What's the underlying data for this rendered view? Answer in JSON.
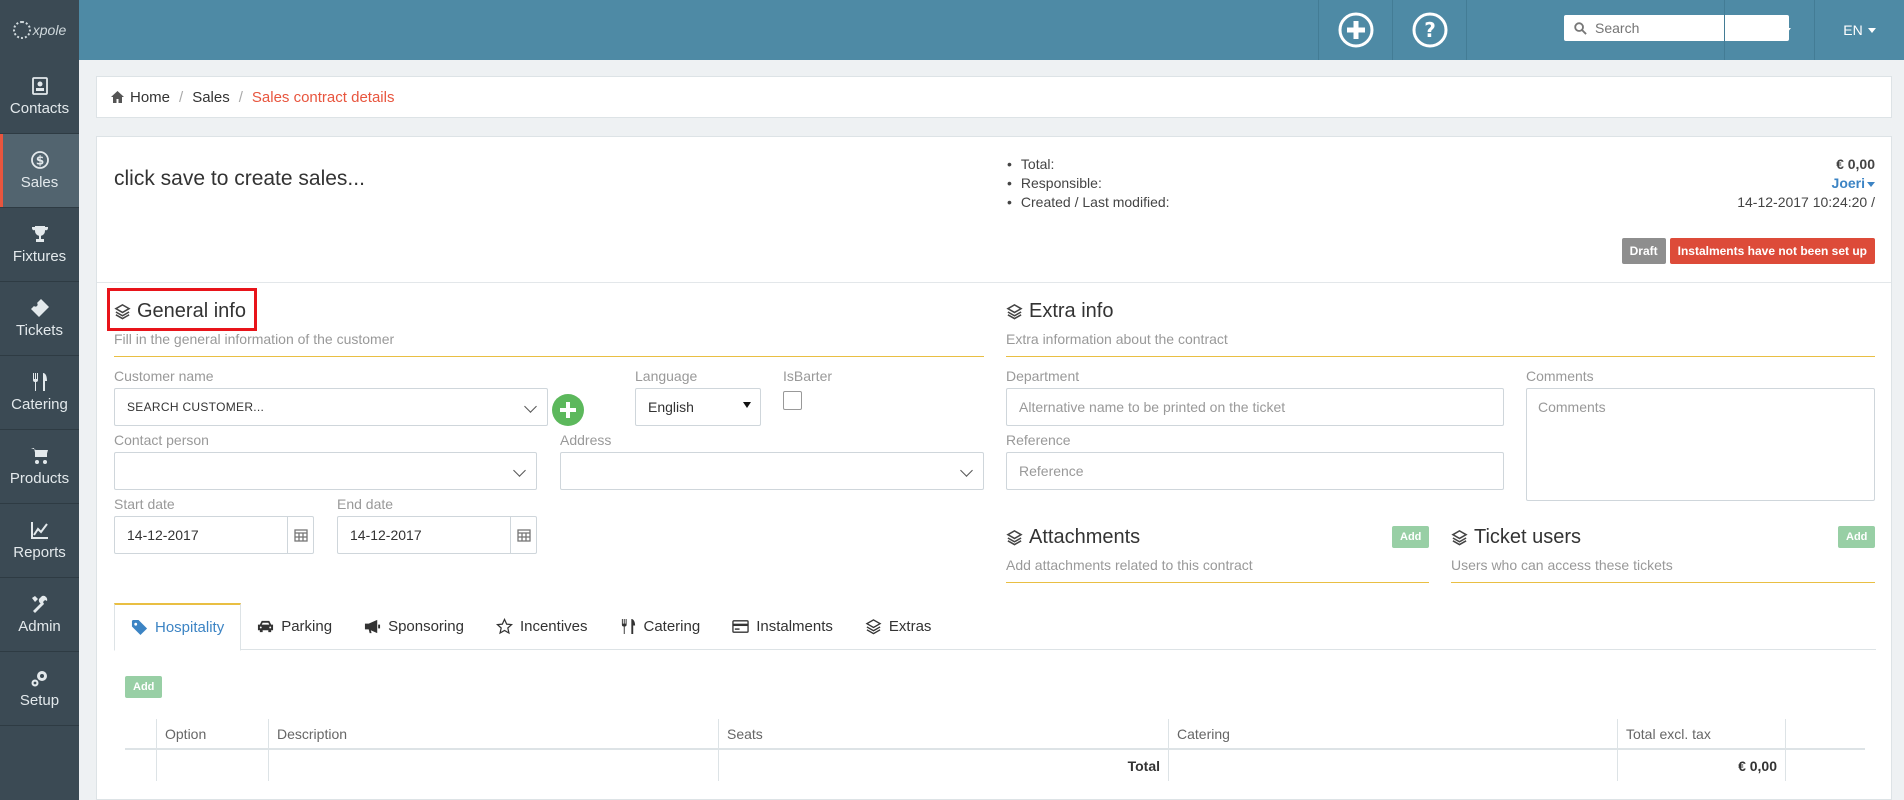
{
  "logo": {
    "text": "xpole"
  },
  "sidebar": {
    "items": [
      {
        "label": "Contacts",
        "icon": "contacts-icon"
      },
      {
        "label": "Sales",
        "icon": "dollar-icon",
        "active": true
      },
      {
        "label": "Fixtures",
        "icon": "trophy-icon"
      },
      {
        "label": "Tickets",
        "icon": "ticket-icon"
      },
      {
        "label": "Catering",
        "icon": "cutlery-icon"
      },
      {
        "label": "Products",
        "icon": "cart-icon"
      },
      {
        "label": "Reports",
        "icon": "chart-icon"
      },
      {
        "label": "Admin",
        "icon": "tools-icon"
      },
      {
        "label": "Setup",
        "icon": "gears-icon"
      }
    ]
  },
  "topbar": {
    "search_placeholder": "Search",
    "user": "Joeri",
    "lang": "EN"
  },
  "breadcrumb": {
    "home": "Home",
    "section": "Sales",
    "current": "Sales contract details"
  },
  "header": {
    "headline": "click save to create sales...",
    "summary": {
      "total_label": "Total:",
      "total_value": "€ 0,00",
      "responsible_label": "Responsible:",
      "responsible_value": "Joeri",
      "created_label": "Created / Last modified:",
      "created_value": "14-12-2017 10:24:20 /"
    },
    "badges": {
      "draft": "Draft",
      "instalments": "Instalments have not been set up"
    }
  },
  "general_info": {
    "title": "General info",
    "subtitle": "Fill in the general information of the customer",
    "customer_label": "Customer name",
    "customer_value": "SEARCH CUSTOMER...",
    "language_label": "Language",
    "language_value": "English",
    "isbarter_label": "IsBarter",
    "contact_label": "Contact person",
    "address_label": "Address",
    "start_label": "Start date",
    "start_value": "14-12-2017",
    "end_label": "End date",
    "end_value": "14-12-2017"
  },
  "extra_info": {
    "title": "Extra info",
    "subtitle": "Extra information about the contract",
    "department_label": "Department",
    "department_placeholder": "Alternative name to be printed on the ticket",
    "reference_label": "Reference",
    "reference_placeholder": "Reference",
    "comments_label": "Comments",
    "comments_placeholder": "Comments"
  },
  "attachments": {
    "title": "Attachments",
    "subtitle": "Add attachments related to this contract",
    "add": "Add"
  },
  "ticket_users": {
    "title": "Ticket users",
    "subtitle": "Users who can access these tickets",
    "add": "Add"
  },
  "tabs": [
    {
      "label": "Hospitality",
      "icon": "tag-icon",
      "active": true
    },
    {
      "label": "Parking",
      "icon": "car-icon"
    },
    {
      "label": "Sponsoring",
      "icon": "megaphone-icon"
    },
    {
      "label": "Incentives",
      "icon": "star-icon"
    },
    {
      "label": "Catering",
      "icon": "cutlery-icon"
    },
    {
      "label": "Instalments",
      "icon": "credit-card-icon"
    },
    {
      "label": "Extras",
      "icon": "layers-icon"
    }
  ],
  "table": {
    "add": "Add",
    "headers": [
      "Option",
      "Description",
      "Seats",
      "Catering",
      "Total excl. tax"
    ],
    "footer_label": "Total",
    "footer_value": "€ 0,00"
  },
  "colors": {
    "accent": "#e8553e",
    "topbar": "#4e8aa5",
    "sidebar": "#3b4a54",
    "link": "#3c84c4"
  }
}
